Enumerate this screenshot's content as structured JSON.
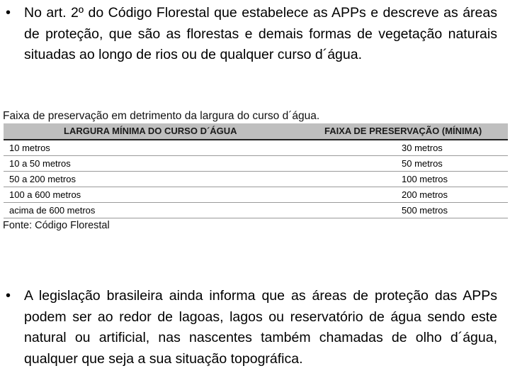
{
  "paragraph_1": {
    "bullet": "•",
    "text": "No art. 2º do Código Florestal que estabelece as APPs e descreve as áreas de proteção, que são as florestas e demais formas de vegetação naturais situadas ao longo de rios ou de qualquer curso d´água."
  },
  "table": {
    "caption": "Faixa de preservação em detrimento da largura do curso d´água.",
    "headers": [
      "LARGURA MÍNIMA DO CURSO D´ÁGUA",
      "FAIXA DE PRESERVAÇÃO  (MÍNIMA)"
    ],
    "rows": [
      [
        "10 metros",
        "30 metros"
      ],
      [
        "10 a 50 metros",
        "50 metros"
      ],
      [
        "50 a 200 metros",
        "100 metros"
      ],
      [
        "100 a 600 metros",
        "200 metros"
      ],
      [
        "acima de 600 metros",
        "500 metros"
      ]
    ],
    "source": "Fonte: Código Florestal"
  },
  "paragraph_2": {
    "bullet": "•",
    "text": "A legislação brasileira ainda informa que as áreas de proteção das APPs podem ser ao redor de lagoas, lagos ou reservatório de água sendo este natural ou artificial, nas nascentes também chamadas de olho d´água, qualquer que seja a sua situação topográfica."
  }
}
